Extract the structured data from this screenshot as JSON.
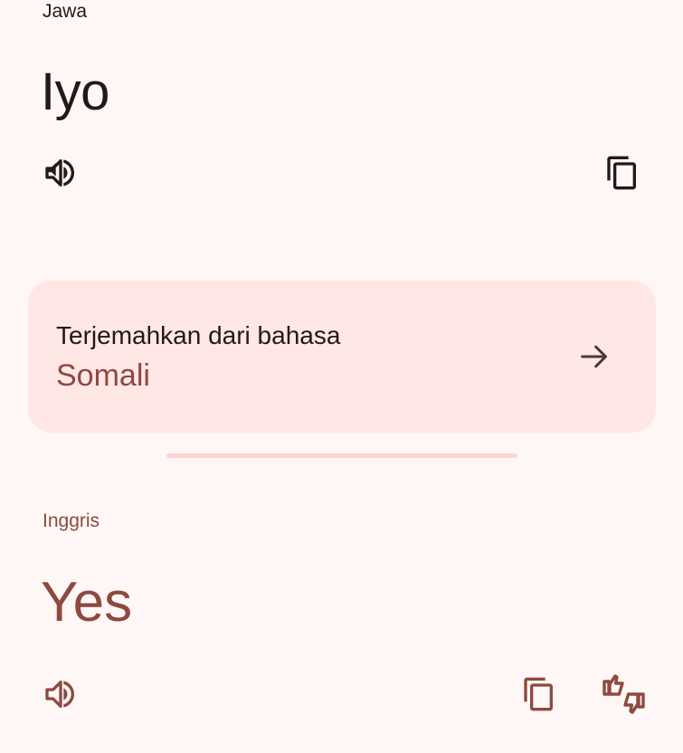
{
  "source": {
    "language_label": "Jawa",
    "text": "Iyo",
    "speak_icon": "volume-icon",
    "copy_icon": "copy-icon"
  },
  "suggestion": {
    "title": "Terjemahkan dari bahasa",
    "language": "Somali",
    "arrow_icon": "arrow-right-icon"
  },
  "target": {
    "language_label": "Inggris",
    "text": "Yes",
    "speak_icon": "volume-icon",
    "copy_icon": "copy-icon",
    "rate_icon": "thumbs-up-down-icon"
  },
  "colors": {
    "background": "#fef7f5",
    "card": "#ffe7e6",
    "accent": "#8d4a3f",
    "on_surface": "#231918",
    "divider": "#f9d7d1"
  }
}
